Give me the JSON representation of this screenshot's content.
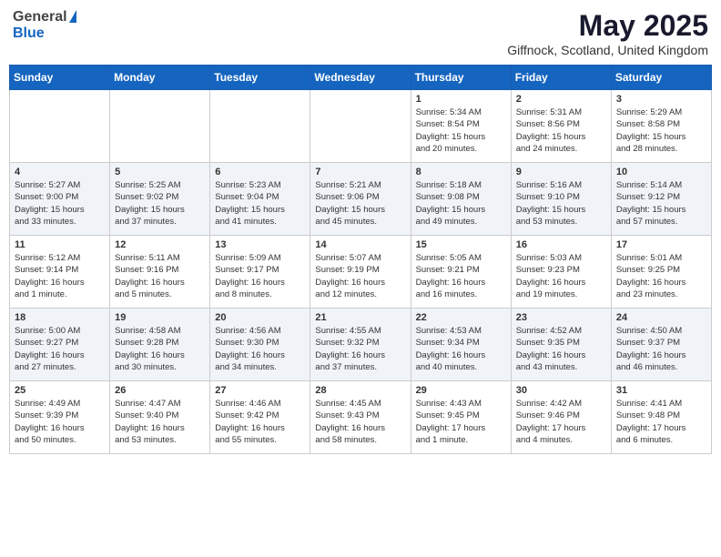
{
  "header": {
    "logo_general": "General",
    "logo_blue": "Blue",
    "month_title": "May 2025",
    "location": "Giffnock, Scotland, United Kingdom"
  },
  "weekdays": [
    "Sunday",
    "Monday",
    "Tuesday",
    "Wednesday",
    "Thursday",
    "Friday",
    "Saturday"
  ],
  "weeks": [
    [
      {
        "day": "",
        "info": ""
      },
      {
        "day": "",
        "info": ""
      },
      {
        "day": "",
        "info": ""
      },
      {
        "day": "",
        "info": ""
      },
      {
        "day": "1",
        "info": "Sunrise: 5:34 AM\nSunset: 8:54 PM\nDaylight: 15 hours\nand 20 minutes."
      },
      {
        "day": "2",
        "info": "Sunrise: 5:31 AM\nSunset: 8:56 PM\nDaylight: 15 hours\nand 24 minutes."
      },
      {
        "day": "3",
        "info": "Sunrise: 5:29 AM\nSunset: 8:58 PM\nDaylight: 15 hours\nand 28 minutes."
      }
    ],
    [
      {
        "day": "4",
        "info": "Sunrise: 5:27 AM\nSunset: 9:00 PM\nDaylight: 15 hours\nand 33 minutes."
      },
      {
        "day": "5",
        "info": "Sunrise: 5:25 AM\nSunset: 9:02 PM\nDaylight: 15 hours\nand 37 minutes."
      },
      {
        "day": "6",
        "info": "Sunrise: 5:23 AM\nSunset: 9:04 PM\nDaylight: 15 hours\nand 41 minutes."
      },
      {
        "day": "7",
        "info": "Sunrise: 5:21 AM\nSunset: 9:06 PM\nDaylight: 15 hours\nand 45 minutes."
      },
      {
        "day": "8",
        "info": "Sunrise: 5:18 AM\nSunset: 9:08 PM\nDaylight: 15 hours\nand 49 minutes."
      },
      {
        "day": "9",
        "info": "Sunrise: 5:16 AM\nSunset: 9:10 PM\nDaylight: 15 hours\nand 53 minutes."
      },
      {
        "day": "10",
        "info": "Sunrise: 5:14 AM\nSunset: 9:12 PM\nDaylight: 15 hours\nand 57 minutes."
      }
    ],
    [
      {
        "day": "11",
        "info": "Sunrise: 5:12 AM\nSunset: 9:14 PM\nDaylight: 16 hours\nand 1 minute."
      },
      {
        "day": "12",
        "info": "Sunrise: 5:11 AM\nSunset: 9:16 PM\nDaylight: 16 hours\nand 5 minutes."
      },
      {
        "day": "13",
        "info": "Sunrise: 5:09 AM\nSunset: 9:17 PM\nDaylight: 16 hours\nand 8 minutes."
      },
      {
        "day": "14",
        "info": "Sunrise: 5:07 AM\nSunset: 9:19 PM\nDaylight: 16 hours\nand 12 minutes."
      },
      {
        "day": "15",
        "info": "Sunrise: 5:05 AM\nSunset: 9:21 PM\nDaylight: 16 hours\nand 16 minutes."
      },
      {
        "day": "16",
        "info": "Sunrise: 5:03 AM\nSunset: 9:23 PM\nDaylight: 16 hours\nand 19 minutes."
      },
      {
        "day": "17",
        "info": "Sunrise: 5:01 AM\nSunset: 9:25 PM\nDaylight: 16 hours\nand 23 minutes."
      }
    ],
    [
      {
        "day": "18",
        "info": "Sunrise: 5:00 AM\nSunset: 9:27 PM\nDaylight: 16 hours\nand 27 minutes."
      },
      {
        "day": "19",
        "info": "Sunrise: 4:58 AM\nSunset: 9:28 PM\nDaylight: 16 hours\nand 30 minutes."
      },
      {
        "day": "20",
        "info": "Sunrise: 4:56 AM\nSunset: 9:30 PM\nDaylight: 16 hours\nand 34 minutes."
      },
      {
        "day": "21",
        "info": "Sunrise: 4:55 AM\nSunset: 9:32 PM\nDaylight: 16 hours\nand 37 minutes."
      },
      {
        "day": "22",
        "info": "Sunrise: 4:53 AM\nSunset: 9:34 PM\nDaylight: 16 hours\nand 40 minutes."
      },
      {
        "day": "23",
        "info": "Sunrise: 4:52 AM\nSunset: 9:35 PM\nDaylight: 16 hours\nand 43 minutes."
      },
      {
        "day": "24",
        "info": "Sunrise: 4:50 AM\nSunset: 9:37 PM\nDaylight: 16 hours\nand 46 minutes."
      }
    ],
    [
      {
        "day": "25",
        "info": "Sunrise: 4:49 AM\nSunset: 9:39 PM\nDaylight: 16 hours\nand 50 minutes."
      },
      {
        "day": "26",
        "info": "Sunrise: 4:47 AM\nSunset: 9:40 PM\nDaylight: 16 hours\nand 53 minutes."
      },
      {
        "day": "27",
        "info": "Sunrise: 4:46 AM\nSunset: 9:42 PM\nDaylight: 16 hours\nand 55 minutes."
      },
      {
        "day": "28",
        "info": "Sunrise: 4:45 AM\nSunset: 9:43 PM\nDaylight: 16 hours\nand 58 minutes."
      },
      {
        "day": "29",
        "info": "Sunrise: 4:43 AM\nSunset: 9:45 PM\nDaylight: 17 hours\nand 1 minute."
      },
      {
        "day": "30",
        "info": "Sunrise: 4:42 AM\nSunset: 9:46 PM\nDaylight: 17 hours\nand 4 minutes."
      },
      {
        "day": "31",
        "info": "Sunrise: 4:41 AM\nSunset: 9:48 PM\nDaylight: 17 hours\nand 6 minutes."
      }
    ]
  ]
}
